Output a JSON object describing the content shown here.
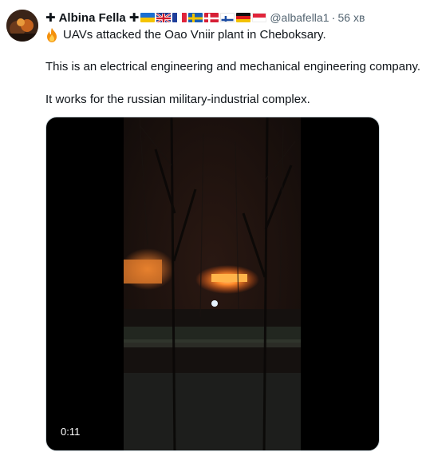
{
  "tweet": {
    "author_name": "Albina Fella",
    "cross_symbol": "✚",
    "handle": "@albafella1",
    "separator": "·",
    "time": "56 хв",
    "flags": [
      "Ukraine",
      "United Kingdom",
      "France",
      "Sweden",
      "Denmark",
      "Finland",
      "Germany",
      "Indonesia"
    ],
    "lines": [
      "UAVs attacked the Oao Vniir plant in Cheboksary.",
      "This is an electrical engineering and mechanical engineering company.",
      "It works for the russian military-industrial complex."
    ],
    "media": {
      "duration": "0:11"
    }
  }
}
